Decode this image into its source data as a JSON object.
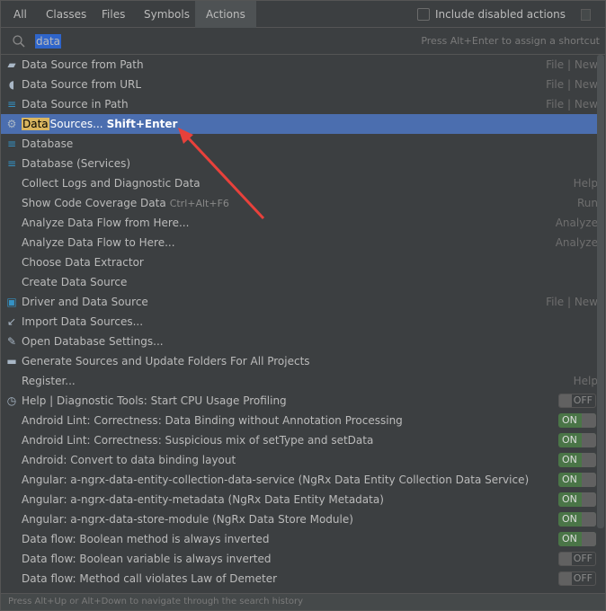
{
  "tabs": [
    "All",
    "Classes",
    "Files",
    "Symbols",
    "Actions"
  ],
  "active_tab": "Actions",
  "include_disabled": {
    "label": "Include disabled actions",
    "checked": false
  },
  "search": {
    "query": "data",
    "hint": "Press Alt+Enter to assign a shortcut"
  },
  "rows": [
    {
      "icon": "folder-open-icon",
      "label": "Data Source from Path",
      "right": "File | New"
    },
    {
      "icon": "plug-icon",
      "label": "Data Source from URL",
      "right": "File | New"
    },
    {
      "icon": "database-icon",
      "label": "Data Source in Path",
      "right": "File | New"
    },
    {
      "icon": "data-sources-icon",
      "label": "Sources...",
      "highlight": "Data",
      "shortcut": "Shift+Enter",
      "selected": true
    },
    {
      "icon": "database-icon",
      "label": "Database"
    },
    {
      "icon": "database-icon",
      "label": "Database (Services)"
    },
    {
      "label": "Collect Logs and Diagnostic Data",
      "right": "Help"
    },
    {
      "label": "Show Code Coverage Data",
      "shortcut_key": "Ctrl+Alt+F6",
      "right": "Run"
    },
    {
      "label": "Analyze Data Flow from Here...",
      "right": "Analyze"
    },
    {
      "label": "Analyze Data Flow to Here...",
      "right": "Analyze"
    },
    {
      "label": "Choose Data Extractor"
    },
    {
      "label": "Create Data Source"
    },
    {
      "icon": "driver-icon",
      "label": "Driver and Data Source",
      "right": "File | New"
    },
    {
      "icon": "import-icon",
      "label": "Import Data Sources..."
    },
    {
      "icon": "wrench-icon",
      "label": "Open Database Settings..."
    },
    {
      "icon": "folder-refresh-icon",
      "label": "Generate Sources and Update Folders For All Projects"
    },
    {
      "label": "Register...",
      "right": "Help"
    },
    {
      "icon": "profiler-icon",
      "label": "Help | Diagnostic Tools: Start CPU Usage Profiling",
      "toggle": "OFF"
    },
    {
      "label": "Android Lint: Correctness: Data Binding without Annotation Processing",
      "toggle": "ON"
    },
    {
      "label": "Android Lint: Correctness: Suspicious mix of setType and setData",
      "toggle": "ON"
    },
    {
      "label": "Android: Convert to data binding layout",
      "toggle": "ON"
    },
    {
      "label": "Angular: a-ngrx-data-entity-collection-data-service (NgRx Data Entity Collection Data Service)",
      "toggle": "ON"
    },
    {
      "label": "Angular: a-ngrx-data-entity-metadata (NgRx Data Entity Metadata)",
      "toggle": "ON"
    },
    {
      "label": "Angular: a-ngrx-data-store-module (NgRx Data Store Module)",
      "toggle": "ON"
    },
    {
      "label": "Data flow: Boolean method is always inverted",
      "toggle": "ON"
    },
    {
      "label": "Data flow: Boolean variable is always inverted",
      "toggle": "OFF"
    },
    {
      "label": "Data flow: Method call violates Law of Demeter",
      "toggle": "OFF"
    }
  ],
  "footer": "Press Alt+Up or Alt+Down to navigate through the search history",
  "colors": {
    "selection": "#4b6eaf",
    "highlight": "#d9b55f",
    "toggle_on": "#4a7547",
    "annotation_arrow": "#e8413b"
  }
}
